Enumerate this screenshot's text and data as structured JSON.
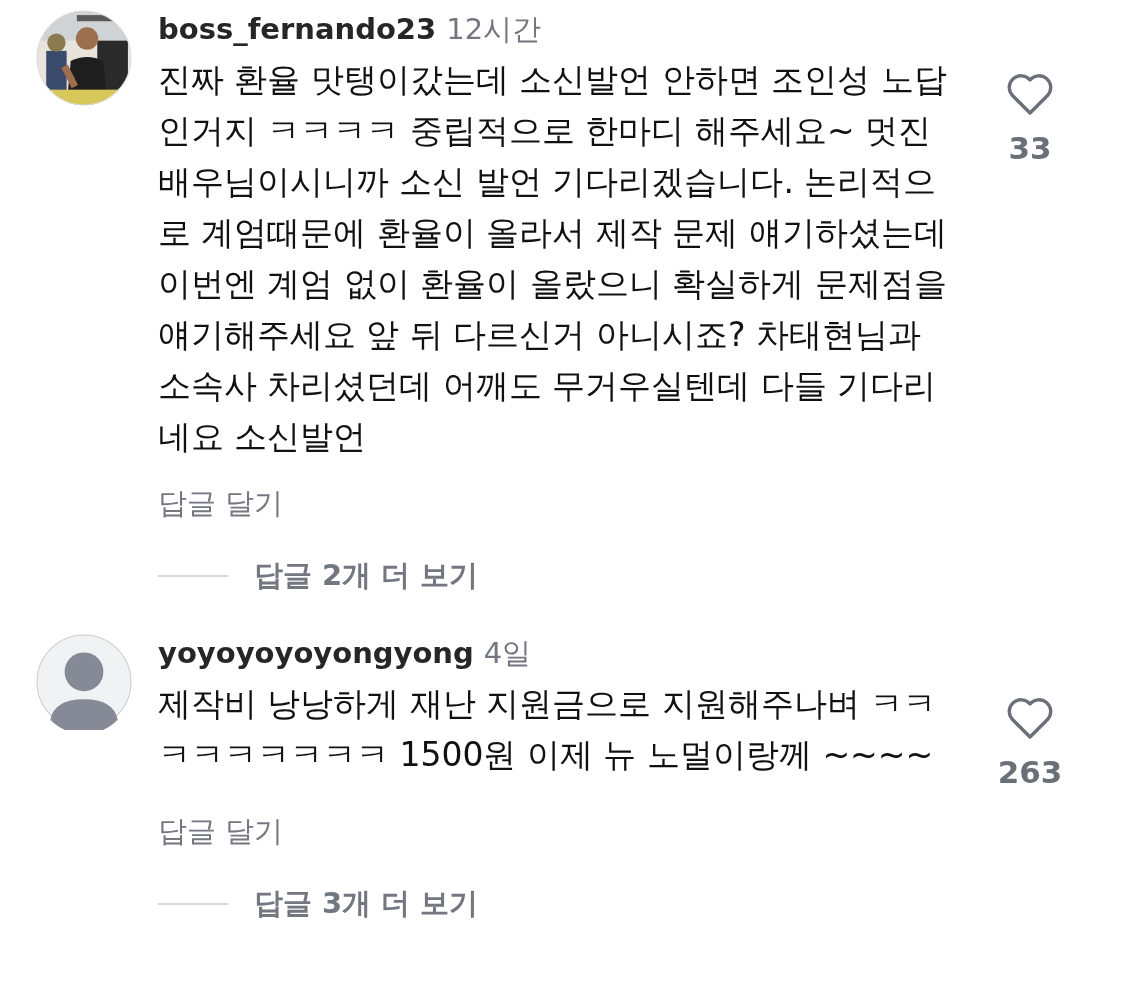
{
  "comments": [
    {
      "username": "boss_fernando23",
      "time": "12시간",
      "text": "진짜 환율 맛탱이갔는데 소신발언 안하면 조인성 노답인거지 ㅋㅋㅋㅋ 중립적으로 한마디 해주세요~ 멋진 배우님이시니까 소신 발언 기다리겠습니다. 논리적으로 계엄때문에 환율이 올라서 제작 문제 얘기하셨는데 이번엔 계엄 없이 환율이 올랐으니 확실하게 문제점을 얘기해주세요 앞 뒤 다르신거 아니시죠? 차태현님과 소속사 차리셨던데 어깨도 무거우실텐데 다들 기다리네요 소신발언",
      "likes": "33",
      "reply": "답글 달기",
      "view_replies": "답글 2개 더 보기"
    },
    {
      "avatar": {
        "kind": "default"
      },
      "username": "yoyoyoyoyongyong",
      "time": "4일",
      "text": "제작비 낭낭하게 재난 지원금으로 지원해주나벼 ㅋㅋㅋㅋㅋㅋㅋㅋㅋ 1500원 이제 뉴 노멀이랑께 ~~~~",
      "likes": "263",
      "reply": "답글 달기",
      "view_replies": "답글 3개 더 보기"
    }
  ]
}
